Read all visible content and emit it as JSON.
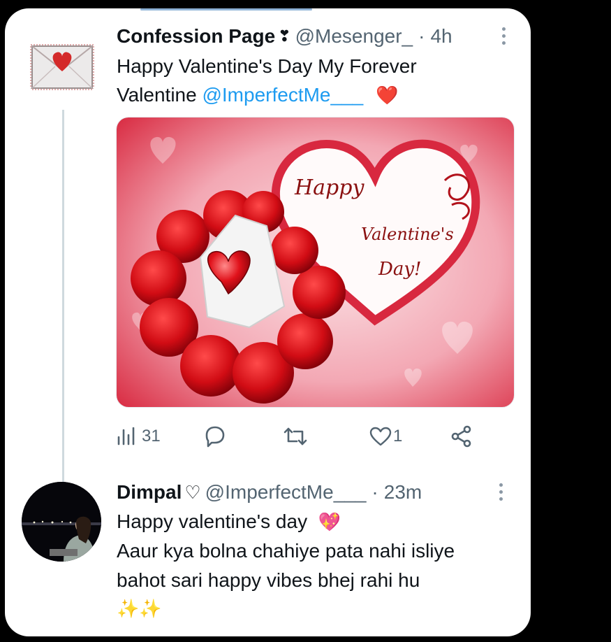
{
  "tweet1": {
    "display_name": "Confession Page",
    "badge": "❣",
    "handle": "@Mesenger_",
    "sep": "·",
    "time": "4h",
    "text_line1": "Happy Valentine's Day My Forever",
    "text_line2_prefix": "Valentine ",
    "mention": "@ImperfectMe___",
    "emoji": "❤️",
    "media": {
      "title_word1": "Happy",
      "title_word2": "Valentine's",
      "title_word3": "Day!"
    },
    "actions": {
      "views_count": "31",
      "like_count": "1"
    }
  },
  "tweet2": {
    "display_name": "Dimpal",
    "badge": "♡",
    "handle": "@ImperfectMe___",
    "sep": "·",
    "time": "23m",
    "line1": "Happy valentine's day",
    "line1_emoji": "💖",
    "line2": "Aaur kya bolna chahiye pata nahi isliye",
    "line3": "bahot sari happy vibes bhej rahi hu",
    "line4": "✨✨"
  },
  "colors": {
    "accent": "#1d9bf0",
    "muted": "#536471",
    "heart_red": "#e0245e"
  }
}
